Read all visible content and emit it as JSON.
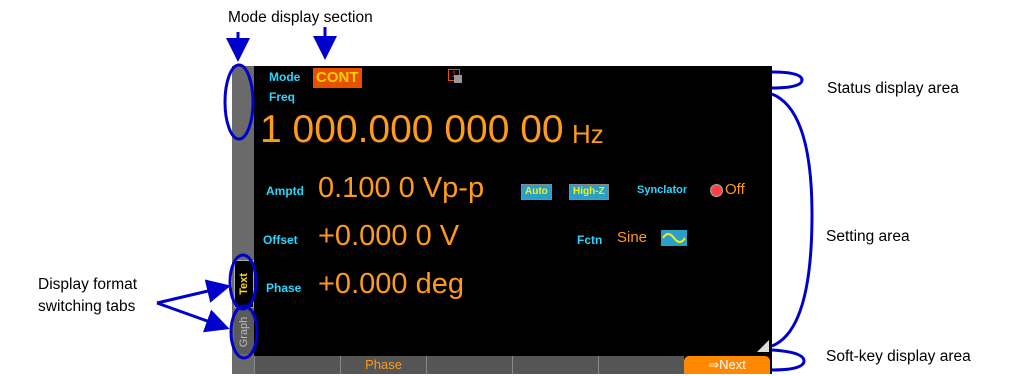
{
  "callouts": {
    "mode_display_section": "Mode display section",
    "status_display_area": "Status display area",
    "setting_area": "Setting area",
    "display_format_tabs_line1": "Display format",
    "display_format_tabs_line2": "switching tabs",
    "soft_key_display_area": "Soft-key display area"
  },
  "screen": {
    "mode_label": "Mode",
    "mode_value": "CONT",
    "channel_indicator": "1",
    "freq_label": "Freq",
    "freq_value": "1 000.000 000 00",
    "freq_unit": "Hz",
    "amptd_label": "Amptd",
    "amptd_value": "0.100 0 Vp-p",
    "auto_chip": "Auto",
    "highz_chip": "High-Z",
    "synclator_label": "Synclator",
    "synclator_value": "Off",
    "offset_label": "Offset",
    "offset_value": "+0.000 0 V",
    "fctn_label": "Fctn",
    "fctn_value": "Sine",
    "phase_label": "Phase",
    "phase_value": "+0.000 deg",
    "tabs": {
      "text": "Text",
      "graph": "Graph"
    },
    "softkeys": [
      "",
      "Phase",
      "",
      "",
      "",
      "⇒Next"
    ]
  },
  "colors": {
    "label_cyan": "#29d6ff",
    "value_orange": "#ff9a1a",
    "annotation_blue": "#0000cc",
    "mode_badge": "#e85000",
    "chip_bg": "#2aa0c8",
    "chip_text": "#ffee00"
  }
}
